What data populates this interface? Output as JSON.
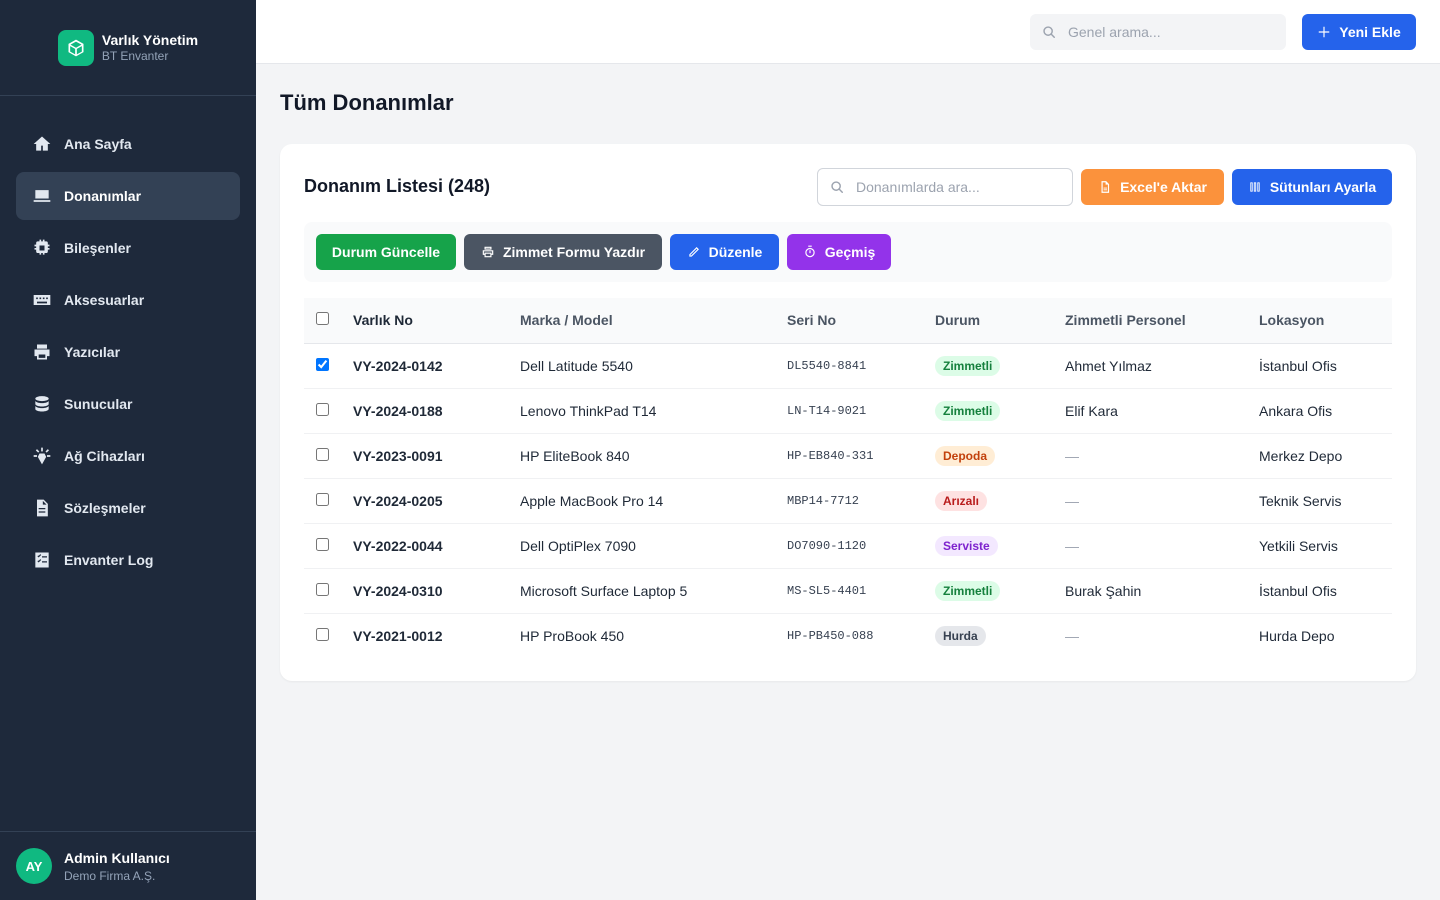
{
  "brand": {
    "title": "Varlık Yönetim",
    "subtitle": "BT Envanter"
  },
  "sidebar": {
    "items": [
      {
        "label": "Ana Sayfa",
        "icon": "home-icon"
      },
      {
        "label": "Donanımlar",
        "icon": "laptop-icon",
        "active": true
      },
      {
        "label": "Bileşenler",
        "icon": "cpu-icon"
      },
      {
        "label": "Aksesuarlar",
        "icon": "keyboard-icon"
      },
      {
        "label": "Yazıcılar",
        "icon": "printer-icon"
      },
      {
        "label": "Sunucular",
        "icon": "database-icon"
      },
      {
        "label": "Ağ Cihazları",
        "icon": "network-icon"
      },
      {
        "label": "Sözleşmeler",
        "icon": "document-icon"
      },
      {
        "label": "Envanter Log",
        "icon": "checklist-icon"
      }
    ]
  },
  "user": {
    "initials": "AY",
    "name": "Admin Kullanıcı",
    "org": "Demo Firma A.Ş."
  },
  "topbar": {
    "search_placeholder": "Genel arama...",
    "new_label": "Yeni Ekle"
  },
  "page": {
    "title": "Tüm Donanımlar"
  },
  "list": {
    "title": "Donanım Listesi (248)",
    "search_placeholder": "Donanımlarda ara...",
    "export_label": "Excel'e Aktar",
    "columns_label": "Sütunları Ayarla"
  },
  "actions": {
    "status_label": "Durum Güncelle",
    "print_label": "Zimmet Formu Yazdır",
    "edit_label": "Düzenle",
    "history_label": "Geçmiş"
  },
  "table": {
    "headers": [
      "Varlık No",
      "Marka / Model",
      "Seri No",
      "Durum",
      "Zimmetli Personel",
      "Lokasyon"
    ],
    "rows": [
      {
        "checked": true,
        "id": "VY-2024-0142",
        "model": "Dell Latitude 5540",
        "serial": "DL5540-8841",
        "status": "Zimmetli",
        "status_type": "assigned",
        "person": "Ahmet Yılmaz",
        "location": "İstanbul Ofis"
      },
      {
        "checked": false,
        "id": "VY-2024-0188",
        "model": "Lenovo ThinkPad T14",
        "serial": "LN-T14-9021",
        "status": "Zimmetli",
        "status_type": "assigned",
        "person": "Elif Kara",
        "location": "Ankara Ofis"
      },
      {
        "checked": false,
        "id": "VY-2023-0091",
        "model": "HP EliteBook 840",
        "serial": "HP-EB840-331",
        "status": "Depoda",
        "status_type": "stock",
        "person": "—",
        "location": "Merkez Depo"
      },
      {
        "checked": false,
        "id": "VY-2024-0205",
        "model": "Apple MacBook Pro 14",
        "serial": "MBP14-7712",
        "status": "Arızalı",
        "status_type": "broken",
        "person": "—",
        "location": "Teknik Servis"
      },
      {
        "checked": false,
        "id": "VY-2022-0044",
        "model": "Dell OptiPlex 7090",
        "serial": "DO7090-1120",
        "status": "Serviste",
        "status_type": "service",
        "person": "—",
        "location": "Yetkili Servis"
      },
      {
        "checked": false,
        "id": "VY-2024-0310",
        "model": "Microsoft Surface Laptop 5",
        "serial": "MS-SL5-4401",
        "status": "Zimmetli",
        "status_type": "assigned",
        "person": "Burak Şahin",
        "location": "İstanbul Ofis"
      },
      {
        "checked": false,
        "id": "VY-2021-0012",
        "model": "HP ProBook 450",
        "serial": "HP-PB450-088",
        "status": "Hurda",
        "status_type": "scrap",
        "person": "—",
        "location": "Hurda Depo"
      }
    ]
  },
  "colors": {
    "sidebar_bg": "#1e293b",
    "accent": "#2563eb",
    "brand_green": "#10b981",
    "status": {
      "assigned": {
        "bg": "#dcfce7",
        "fg": "#15803d"
      },
      "stock": {
        "bg": "#ffedd5",
        "fg": "#c2410c"
      },
      "broken": {
        "bg": "#fee2e2",
        "fg": "#b91c1c"
      },
      "service": {
        "bg": "#f3e8ff",
        "fg": "#7e22ce"
      },
      "scrap": {
        "bg": "#e5e7eb",
        "fg": "#374151"
      }
    }
  }
}
